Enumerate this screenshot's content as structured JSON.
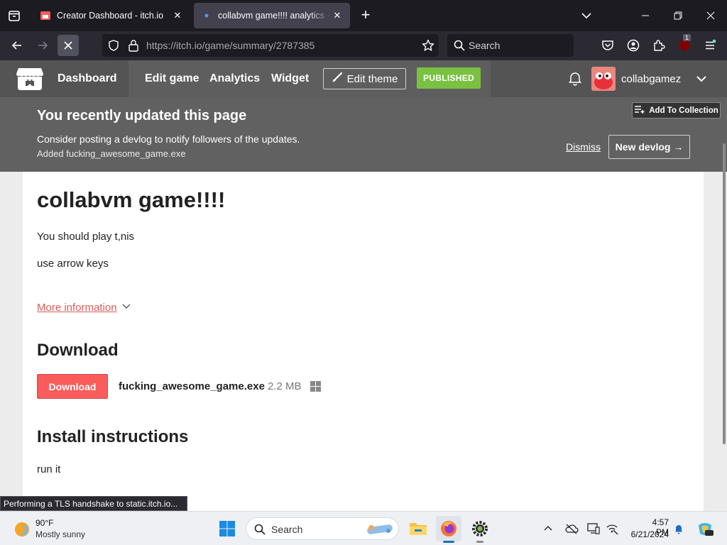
{
  "browser": {
    "tabs": [
      {
        "title": "Creator Dashboard - itch.io",
        "active": false
      },
      {
        "title": "collabvm game!!!! analytics - itch.io",
        "active": true
      }
    ],
    "url": "https://itch.io/game/summary/2787385",
    "search_placeholder": "Search",
    "extension_badge": "1",
    "status_text": "Performing a TLS handshake to static.itch.io..."
  },
  "itch_header": {
    "dashboard": "Dashboard",
    "nav": [
      "Edit game",
      "Analytics",
      "Widget"
    ],
    "edit_theme": "Edit theme",
    "published": "PUBLISHED",
    "username": "collabgamez"
  },
  "banner": {
    "title": "You recently updated this page",
    "message": "Consider posting a devlog to notify followers of the updates.",
    "added": "Added fucking_awesome_game.exe",
    "dismiss": "Dismiss",
    "new_devlog": "New devlog →",
    "add_to_collection": "Add To Collection"
  },
  "game": {
    "title": "collabvm game!!!!",
    "description": [
      "You should play t,nis",
      "use arrow keys"
    ],
    "more_info": "More information",
    "download_heading": "Download",
    "download_button": "Download",
    "file_name": "fucking_awesome_game.exe",
    "file_size": "2.2 MB",
    "install_heading": "Install instructions",
    "install_text": "run it"
  },
  "taskbar": {
    "temperature": "90°F",
    "condition": "Mostly sunny",
    "search_placeholder": "Search",
    "time": "4:57 PM",
    "date": "6/21/2024"
  },
  "colors": {
    "itch_red": "#fa5c5c",
    "published_green": "#7ac142",
    "link_red": "#da5b5b"
  }
}
